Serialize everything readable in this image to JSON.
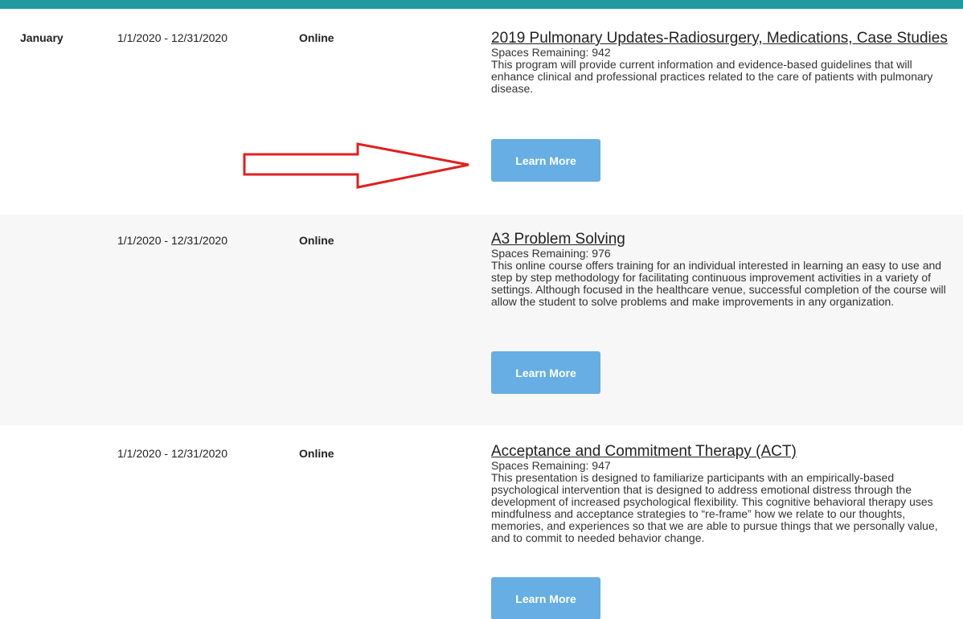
{
  "colors": {
    "top_bar": "#1e9aa0",
    "button": "#66aee3",
    "arrow": "#e02020"
  },
  "courses": [
    {
      "month": "January",
      "dates": "1/1/2020 - 12/31/2020",
      "location": "Online",
      "title": "2019 Pulmonary Updates-Radiosurgery, Medications, Case Studies",
      "spaces": "Spaces Remaining: 942",
      "description": "This program will provide current information and evidence-based guidelines that will enhance clinical and professional practices related to the care of patients with pulmonary disease.",
      "button": "Learn More"
    },
    {
      "month": "",
      "dates": "1/1/2020 - 12/31/2020",
      "location": "Online",
      "title": "A3 Problem Solving",
      "spaces": "Spaces Remaining: 976",
      "description": "This online course offers training for an individual interested in learning an easy to use and step by step methodology for facilitating continuous improvement activities in a variety of settings. Although focused in the healthcare venue, successful completion of the course will allow the student to solve problems and make improvements in any organization.",
      "button": "Learn More"
    },
    {
      "month": "",
      "dates": "1/1/2020 - 12/31/2020",
      "location": "Online",
      "title": "Acceptance and Commitment Therapy (ACT)",
      "spaces": "Spaces Remaining: 947",
      "description": "This presentation is designed to familiarize participants with an empirically-based psychological intervention that is designed to address emotional distress through the development of increased psychological flexibility. This cognitive behavioral therapy uses mindfulness and acceptance strategies to “re-frame” how we relate to our thoughts, memories, and experiences so that we are able to pursue things that we personally value, and to commit to needed behavior change.",
      "button": "Learn More"
    }
  ]
}
